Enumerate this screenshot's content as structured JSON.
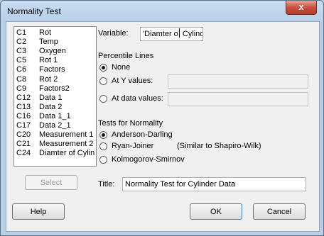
{
  "window": {
    "title": "Normality Test",
    "close_label": "x"
  },
  "columns": [
    {
      "id": "C1",
      "name": "Rot"
    },
    {
      "id": "C2",
      "name": "Temp"
    },
    {
      "id": "C3",
      "name": "Oxygen"
    },
    {
      "id": "C5",
      "name": "Rot 1"
    },
    {
      "id": "C6",
      "name": "Factors"
    },
    {
      "id": "C8",
      "name": "Rot 2"
    },
    {
      "id": "C9",
      "name": "Factors2"
    },
    {
      "id": "C12",
      "name": "Data 1"
    },
    {
      "id": "C13",
      "name": "Data 2"
    },
    {
      "id": "C16",
      "name": "Data 1_1"
    },
    {
      "id": "C17",
      "name": "Data 2_1"
    },
    {
      "id": "C20",
      "name": "Measurement 1"
    },
    {
      "id": "C21",
      "name": "Measurement 2"
    },
    {
      "id": "C24",
      "name": "Diamter of Cylin"
    }
  ],
  "select_label": "Select",
  "variable": {
    "label": "Variable:",
    "value_a": "'Diamter o",
    "value_b": " Cylind"
  },
  "percentile": {
    "heading": "Percentile Lines",
    "none_label": "None",
    "y_label": "At Y values:",
    "data_label": "At data values:"
  },
  "tests": {
    "heading": "Tests for Normality",
    "ad_label": "Anderson-Darling",
    "rj_label": "Ryan-Joiner",
    "rj_note": "(Similar to Shapiro-Wilk)",
    "ks_label": "Kolmogorov-Smirnov"
  },
  "title_field": {
    "label": "Title:",
    "value": "Normality Test for Cylinder Data"
  },
  "buttons": {
    "help": "Help",
    "ok": "OK",
    "cancel": "Cancel"
  }
}
